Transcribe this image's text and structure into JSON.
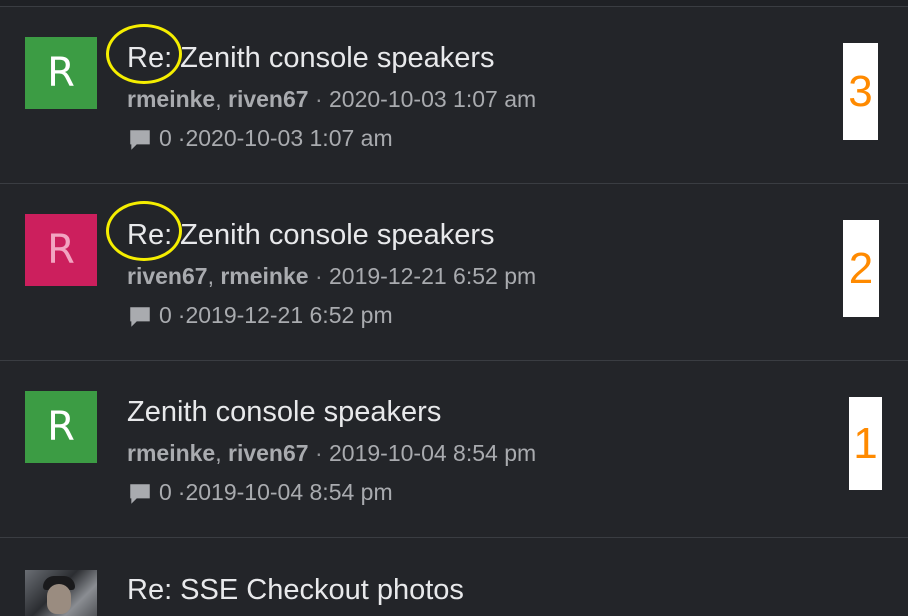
{
  "topics": [
    {
      "avatar_letter": "R",
      "title": "Re: Zenith console speakers",
      "author1": "rmeinke",
      "author2": "riven67",
      "posted": "2020-10-03 1:07 am",
      "reply_count": "0",
      "last_activity": "2020-10-03 1:07 am",
      "annotation": "3"
    },
    {
      "avatar_letter": "R",
      "title": "Re: Zenith console speakers",
      "author1": "riven67",
      "author2": "rmeinke",
      "posted": "2019-12-21 6:52 pm",
      "reply_count": "0",
      "last_activity": "2019-12-21 6:52 pm",
      "annotation": "2"
    },
    {
      "avatar_letter": "R",
      "title": "Zenith console speakers",
      "author1": "rmeinke",
      "author2": "riven67",
      "posted": "2019-10-04 8:54 pm",
      "reply_count": "0",
      "last_activity": "2019-10-04 8:54 pm",
      "annotation": "1"
    },
    {
      "title": "Re: SSE Checkout photos"
    }
  ],
  "separators": {
    "comma": ", ",
    "dot": " · "
  },
  "icons": {
    "comment": "comment-bubble-icon",
    "highlight": "yellow-circle-highlight"
  },
  "colors": {
    "background": "#232529",
    "avatar_green": "#3c9c44",
    "avatar_pink": "#cc1f5d",
    "annotation_number": "#ff8a00",
    "highlight_circle": "#f5ee00"
  }
}
